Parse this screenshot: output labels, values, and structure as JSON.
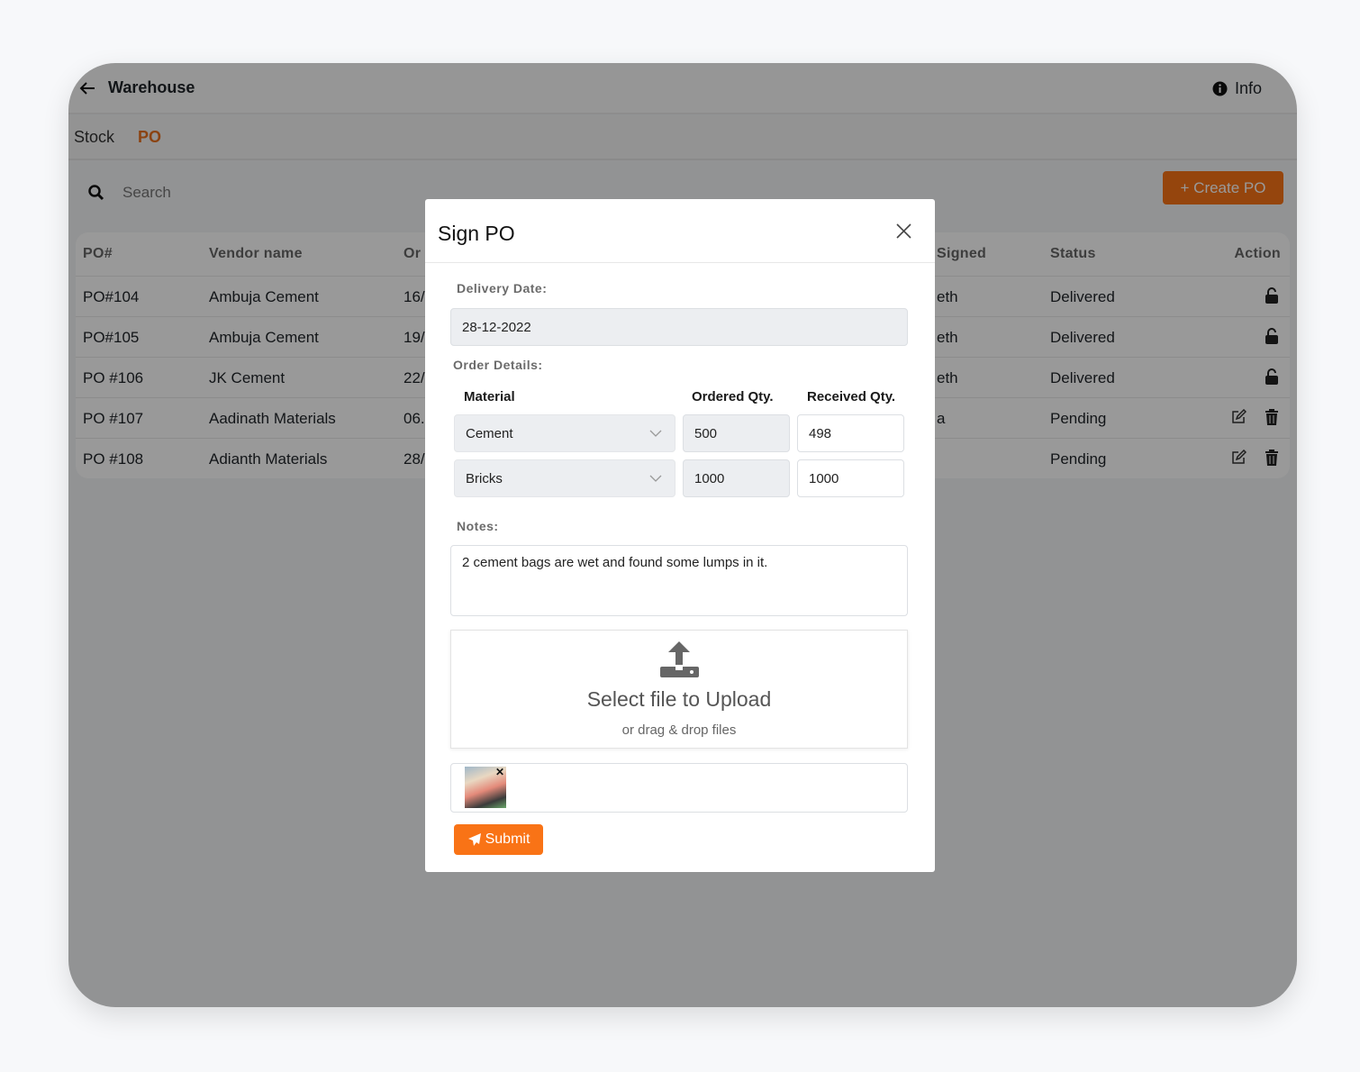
{
  "app": {
    "title": "Warehouse",
    "info_label": "Info"
  },
  "tabs": [
    {
      "label": "Stock",
      "active": false
    },
    {
      "label": "PO",
      "active": true
    }
  ],
  "search": {
    "placeholder": "Search"
  },
  "create_button": "+ Create PO",
  "colors": {
    "accent": "#f97316",
    "active_tab": "#e8711f"
  },
  "table": {
    "headers": {
      "po": "PO#",
      "vendor": "Vendor name",
      "order_partial": "Or",
      "signed_partial": "Signed",
      "status": "Status",
      "action": "Action"
    },
    "rows": [
      {
        "po": "PO#104",
        "vendor": "Ambuja Cement",
        "order_partial": "16/",
        "signed_partial": "eth",
        "status": "Delivered",
        "actions": [
          "unlock-icon"
        ]
      },
      {
        "po": "PO#105",
        "vendor": "Ambuja Cement",
        "order_partial": "19/",
        "signed_partial": "eth",
        "status": "Delivered",
        "actions": [
          "unlock-icon"
        ]
      },
      {
        "po": "PO #106",
        "vendor": "JK Cement",
        "order_partial": "22/",
        "signed_partial": "eth",
        "status": "Delivered",
        "actions": [
          "unlock-icon"
        ]
      },
      {
        "po": "PO #107",
        "vendor": "Aadinath Materials",
        "order_partial": "06.",
        "signed_partial": "a",
        "status": "Pending",
        "actions": [
          "edit-icon",
          "trash-icon"
        ]
      },
      {
        "po": "PO #108",
        "vendor": "Adianth Materials",
        "order_partial": "28/",
        "signed_partial": "",
        "status": "Pending",
        "actions": [
          "edit-icon",
          "trash-icon"
        ]
      }
    ]
  },
  "modal": {
    "title": "Sign PO",
    "delivery_label": "Delivery Date:",
    "delivery_value": "28-12-2022",
    "order_label": "Order Details:",
    "col_material": "Material",
    "col_ordered": "Ordered Qty.",
    "col_received": "Received Qty.",
    "items": [
      {
        "material": "Cement",
        "ordered": "500",
        "received": "498"
      },
      {
        "material": "Bricks",
        "ordered": "1000",
        "received": "1000"
      }
    ],
    "notes_label": "Notes:",
    "notes_value": "2 cement bags are wet and found some lumps in it.",
    "upload_title": "Select file to Upload",
    "upload_sub": "or drag & drop files",
    "submit_label": "Submit"
  }
}
